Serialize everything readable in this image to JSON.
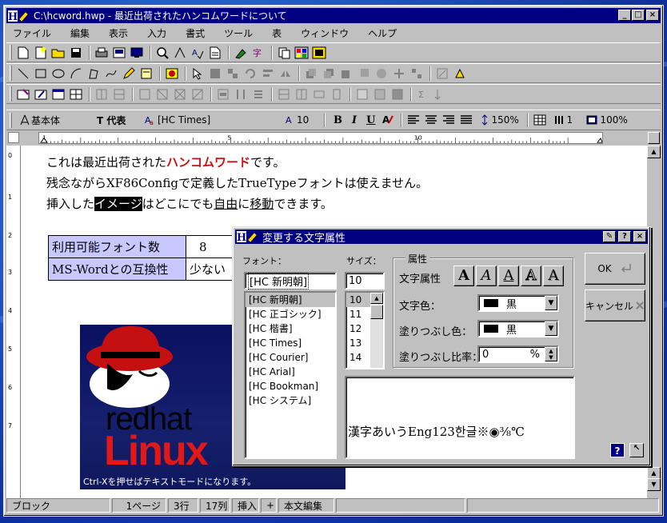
{
  "window": {
    "app_badge": "H",
    "title": "C:\\hcword.hwp  -  最近出荷されたハンコムワードについて"
  },
  "menubar": [
    "ファイル",
    "編集",
    "表示",
    "入力",
    "書式",
    "ツール",
    "表",
    "ウィンドウ",
    "ヘルプ"
  ],
  "format_bar": {
    "style": "基本体",
    "font_category": "T 代表",
    "font_name": "[HC  Times]",
    "font_size": "10",
    "bold": "B",
    "italic": "I",
    "underline": "U",
    "line_spacing": "150%",
    "columns": "1",
    "zoom": "100%"
  },
  "ruler_numbers": [
    "1",
    "5",
    "10",
    "15"
  ],
  "vruler_numbers": [
    "0",
    "1",
    "2",
    "3",
    "4",
    "5",
    "6",
    "7"
  ],
  "document": {
    "line1": {
      "before": "これは最近出荷された",
      "highlight": "ハンコムワード",
      "after": "です。"
    },
    "line2": "残念ながらXF86Configで定義したTrueTypeフォントは使えません。",
    "line3": {
      "before": "挿入した",
      "inverted": "イメージ",
      "middle": "はどこにでも",
      "underlined1": "自由",
      "mid2": "に",
      "underlined2": "移動",
      "after": "できます。"
    },
    "table": [
      {
        "label": "利用可能フォント数",
        "value": "8"
      },
      {
        "label": "MS-Wordとの互換性",
        "value": "少ない"
      }
    ],
    "image": {
      "word_red": "red",
      "word_hat": "hat",
      "linux": "Linux",
      "caption": "Ctrl-Xを押せばテキストモードになります。"
    }
  },
  "statusbar": {
    "mode": "ブロック",
    "page": "1ページ",
    "row": "3行",
    "col": "17列",
    "insert": "挿入",
    "plus": "+",
    "text_mode": "本文編集"
  },
  "dialog": {
    "badge": "H",
    "title": "変更する文字属性",
    "font_label": "フォント：",
    "size_label": "サイズ：",
    "font_value": "[HC  新明朝]",
    "size_value": "10",
    "font_list": [
      "[HC  新明朝]",
      "[HC  正ゴシック]",
      "[HC  楷書]",
      "[HC  Times]",
      "[HC  Courier]",
      "[HC  Arial]",
      "[HC  Bookman]",
      "[HC  システム]"
    ],
    "size_list": [
      "10",
      "11",
      "12",
      "13",
      "14"
    ],
    "attr_group": "属性",
    "attr_label": "文字属性",
    "attr_buttons": [
      "A",
      "A",
      "A",
      "A",
      "A"
    ],
    "text_color_label": "文字色：",
    "text_color_value": "黒",
    "fill_color_label": "塗りつぶし色：",
    "fill_color_value": "黒",
    "fill_ratio_label": "塗りつぶし比率：",
    "fill_ratio_value": "0",
    "fill_ratio_unit": "%",
    "ok_label": "OK",
    "cancel_label": "キャンセル",
    "preview_text": "漢字あいうEng123한글※◉⅜℃"
  },
  "colors": {
    "titlebar": "#000080",
    "desktop": "#1646b8",
    "table_header": "#c8c8ff",
    "highlight_red": "#d01010",
    "linux_red": "#e01818"
  }
}
